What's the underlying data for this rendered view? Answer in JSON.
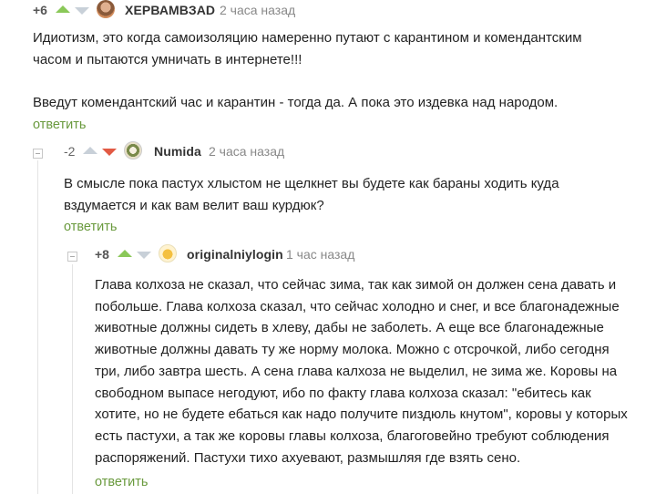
{
  "comments": [
    {
      "rating": "+6",
      "username": "ХЕРВАМВЗАD",
      "time": "2 часа назад",
      "text": "Идиотизм, это когда самоизоляцию намеренно путают с карантином и комендантским\nчасом и пытаются умничать в интернете!!!\n\nВведут комендантский час и карантин - тогда да. А пока это издевка над народом.",
      "reply_label": "ответить"
    },
    {
      "rating": "-2",
      "username": "Numida",
      "time": "2 часа назад",
      "text": "В смысле пока пастух хлыстом не щелкнет вы будете как бараны ходить куда\nвздумается и как вам велит ваш курдюк?",
      "reply_label": "ответить"
    },
    {
      "rating": "+8",
      "username": "originalniylogin",
      "time": "1 час назад",
      "text": "Глава колхоза не сказал, что сейчас зима, так как зимой он должен сена давать и\nпобольше. Глава колхоза сказал, что сейчас холодно и снег, и все благонадежные\nживотные должны сидеть в хлеву, дабы не заболеть. А еще все благонадежные\nживотные должны давать ту же норму молока. Можно с отсрочкой, либо сегодня\nтри, либо завтра шесть. А сена глава калхоза не выделил, не зима же. Коровы на\nсвободном выпасе негодуют, ибо по факту глава колхоза сказал: \"ебитесь как\nхотите, но не будете ебаться как надо получите пиздюль кнутом\", коровы у которых\nесть пастухи, а так же коровы главы колхоза, благоговейно требуют соблюдения\nраспоряжений. Пастухи тихо ахуевают, размышляя где взять сено.",
      "reply_label": "ответить"
    }
  ],
  "colors": {
    "vote_up_active": "#8ac858",
    "vote_down_active": "#e25a44",
    "reply_link": "#6a9a3e"
  }
}
